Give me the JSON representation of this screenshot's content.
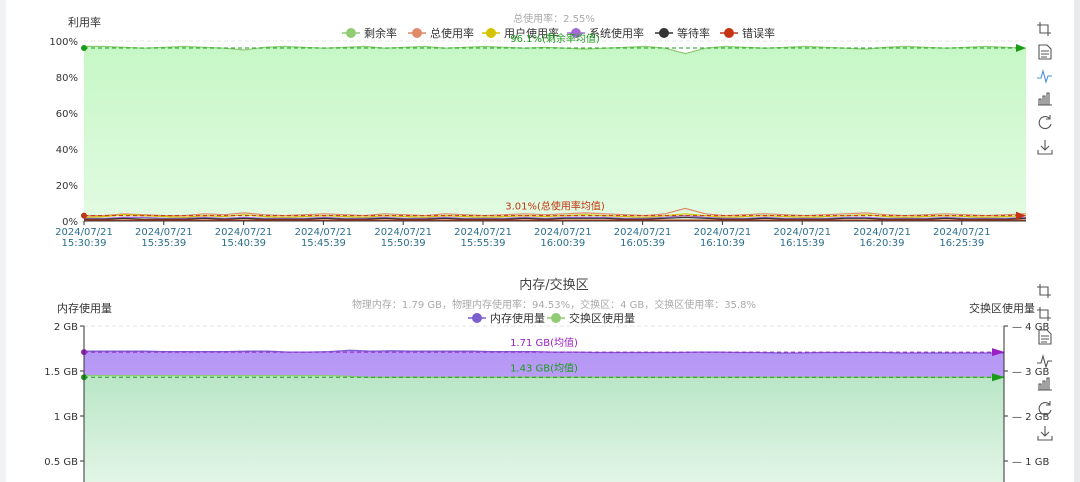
{
  "chart_data": [
    {
      "type": "area",
      "title": "",
      "subtitle": "总使用率：2.55%",
      "ylabel": "利用率",
      "y_ticks": [
        "0%",
        "20%",
        "40%",
        "60%",
        "80%",
        "100%"
      ],
      "ylim": [
        0,
        100
      ],
      "x_ticks": [
        [
          "2024/07/21",
          "15:30:39"
        ],
        [
          "2024/07/21",
          "15:35:39"
        ],
        [
          "2024/07/21",
          "15:40:39"
        ],
        [
          "2024/07/21",
          "15:45:39"
        ],
        [
          "2024/07/21",
          "15:50:39"
        ],
        [
          "2024/07/21",
          "15:55:39"
        ],
        [
          "2024/07/21",
          "16:00:39"
        ],
        [
          "2024/07/21",
          "16:05:39"
        ],
        [
          "2024/07/21",
          "16:10:39"
        ],
        [
          "2024/07/21",
          "16:15:39"
        ],
        [
          "2024/07/21",
          "16:20:39"
        ],
        [
          "2024/07/21",
          "16:25:39"
        ]
      ],
      "legend_position": "top-center",
      "series": [
        {
          "name": "剩余率",
          "color": "#91cc75",
          "fill": "#cdf7cd",
          "values": [
            97,
            97,
            96.5,
            96,
            96.5,
            97,
            96.5,
            96,
            95,
            96.5,
            97,
            96.5,
            96,
            96.5,
            97,
            96,
            96.5,
            97,
            96,
            96.5,
            97,
            96.5,
            96,
            96.5,
            96,
            95.5,
            96,
            96.5,
            97,
            96,
            93,
            96,
            97,
            96.5,
            96,
            96.5,
            97,
            96.5,
            96,
            95.5,
            96.5,
            97,
            96.5,
            96,
            96.5,
            97,
            96.5,
            96
          ]
        },
        {
          "name": "总使用率",
          "color": "#e08a6a",
          "values": [
            3,
            3,
            4,
            3.5,
            3,
            3,
            4,
            3.5,
            4.5,
            3.5,
            3,
            3.5,
            4,
            3.5,
            3,
            4,
            3.5,
            3,
            4,
            3.5,
            3,
            3.5,
            4,
            3.5,
            4,
            4.5,
            4,
            3.5,
            3,
            4,
            7,
            4,
            3,
            3.5,
            4,
            3.5,
            3,
            3.5,
            4,
            4.5,
            3.5,
            3,
            3.5,
            4,
            3.5,
            3,
            3.5,
            4
          ]
        },
        {
          "name": "用户使用率",
          "color": "#d4c400",
          "values": [
            2,
            2.5,
            3.5,
            3,
            2.5,
            2,
            3,
            2.5,
            3.5,
            2.5,
            2,
            2.5,
            3,
            2.5,
            2,
            3,
            2.5,
            2,
            3,
            2.5,
            2,
            2.5,
            3,
            2.5,
            3,
            3.5,
            3,
            2.5,
            2,
            3,
            4,
            3,
            2,
            2.5,
            3,
            2.5,
            2,
            2.5,
            3,
            3.5,
            2.5,
            2,
            2.5,
            3,
            2.5,
            2,
            2.5,
            3
          ]
        },
        {
          "name": "系统使用率",
          "color": "#a66bd3",
          "values": [
            1.5,
            1.5,
            2,
            2,
            1.5,
            1.5,
            2,
            1.5,
            2,
            1.5,
            1.5,
            1.5,
            2,
            1.5,
            1.5,
            2,
            1.5,
            1.5,
            2,
            1.5,
            1.5,
            1.5,
            2,
            1.5,
            2,
            2,
            2,
            1.5,
            1.5,
            2,
            3,
            2,
            1.5,
            1.5,
            2,
            1.5,
            1.5,
            1.5,
            2,
            2,
            1.5,
            1.5,
            1.5,
            2,
            1.5,
            1.5,
            1.5,
            2
          ]
        },
        {
          "name": "等待率",
          "color": "#333333",
          "values": [
            1,
            1,
            1.5,
            1,
            1,
            1,
            1.5,
            1,
            1.5,
            1,
            1,
            1,
            1.5,
            1,
            1,
            1.5,
            1,
            1,
            1.5,
            1,
            1,
            1,
            1.5,
            1,
            1.5,
            1.5,
            1.5,
            1,
            1,
            1.5,
            2,
            1.5,
            1,
            1,
            1.5,
            1,
            1,
            1,
            1.5,
            1.5,
            1,
            1,
            1,
            1.5,
            1,
            1,
            1,
            1.5
          ]
        },
        {
          "name": "错误率",
          "color": "#c23513",
          "values": [
            0.5,
            0.5,
            0.5,
            0.5,
            0.5,
            0.5,
            0.5,
            0.5,
            0.5,
            0.5,
            0.5,
            0.5,
            0.5,
            0.5,
            0.5,
            0.5,
            0.5,
            0.5,
            0.5,
            0.5,
            0.5,
            0.5,
            0.5,
            0.5,
            0.5,
            0.5,
            0.5,
            0.5,
            0.5,
            0.5,
            0.5,
            0.5,
            0.5,
            0.5,
            0.5,
            0.5,
            0.5,
            0.5,
            0.5,
            0.5,
            0.5,
            0.5,
            0.5,
            0.5,
            0.5,
            0.5,
            0.5,
            0.5
          ]
        }
      ],
      "mark_lines": [
        {
          "label": "96.1%(剩余率均值)",
          "value": 96.1,
          "color": "#1a9c1a"
        },
        {
          "label": "3.01%(总使用率均值)",
          "value": 3.01,
          "color": "#c23513"
        }
      ]
    },
    {
      "type": "area",
      "title": "内存/交换区",
      "subtitle": "物理内存：1.79 GB，物理内存使用率：94.53%，交换区：4 GB，交换区使用率：35.8%",
      "ylabel": "内存使用量",
      "y2label": "交换区使用量",
      "y_ticks": [
        "0.5 GB",
        "1 GB",
        "1.5 GB",
        "2 GB"
      ],
      "y2_ticks": [
        "1 GB",
        "2 GB",
        "3 GB",
        "4 GB"
      ],
      "ylim": [
        0,
        2
      ],
      "y2lim": [
        0,
        4
      ],
      "legend_position": "top-center",
      "series": [
        {
          "name": "内存使用量",
          "color": "#7b5fd0",
          "fill": "#c2a6f7",
          "axis": "left",
          "values": [
            1.72,
            1.72,
            1.72,
            1.72,
            1.715,
            1.715,
            1.715,
            1.715,
            1.72,
            1.72,
            1.71,
            1.71,
            1.715,
            1.73,
            1.72,
            1.725,
            1.72,
            1.72,
            1.72,
            1.72,
            1.715,
            1.715,
            1.715,
            1.71,
            1.71,
            1.705,
            1.705,
            1.705,
            1.705,
            1.705,
            1.71,
            1.71,
            1.705,
            1.705,
            1.7,
            1.7,
            1.705,
            1.705,
            1.705,
            1.705,
            1.7,
            1.7,
            1.7,
            1.7,
            1.7,
            1.7
          ]
        },
        {
          "name": "交换区使用量",
          "color": "#91cc75",
          "fill": "#cdeed6",
          "axis": "right",
          "values": [
            2.9,
            2.9,
            2.9,
            2.9,
            2.9,
            2.9,
            2.9,
            2.9,
            2.9,
            2.9,
            2.9,
            2.9,
            2.9,
            2.88,
            2.86,
            2.86,
            2.86,
            2.86,
            2.86,
            2.86,
            2.86,
            2.86,
            2.86,
            2.86,
            2.86,
            2.86,
            2.86,
            2.86,
            2.86,
            2.86,
            2.86,
            2.86,
            2.86,
            2.86,
            2.86,
            2.86,
            2.86,
            2.86,
            2.86,
            2.86,
            2.86,
            2.86,
            2.86,
            2.86,
            2.86,
            2.86
          ]
        }
      ],
      "mark_lines": [
        {
          "label": "1.71 GB(均值)",
          "value": 1.71,
          "color": "#9b1fc2"
        },
        {
          "label": "1.43 GB(均值)",
          "value": 1.43,
          "color": "#1a9c1a"
        }
      ]
    }
  ],
  "toolbox": {
    "top": [
      "restore-icon",
      "data-view-icon",
      "line-chart-icon",
      "bar-chart-icon",
      "refresh-icon",
      "download-icon"
    ],
    "bottom": [
      "zoom-icon",
      "restore-icon",
      "data-view-icon",
      "line-chart-icon",
      "bar-chart-icon",
      "refresh-icon",
      "download-icon"
    ]
  }
}
